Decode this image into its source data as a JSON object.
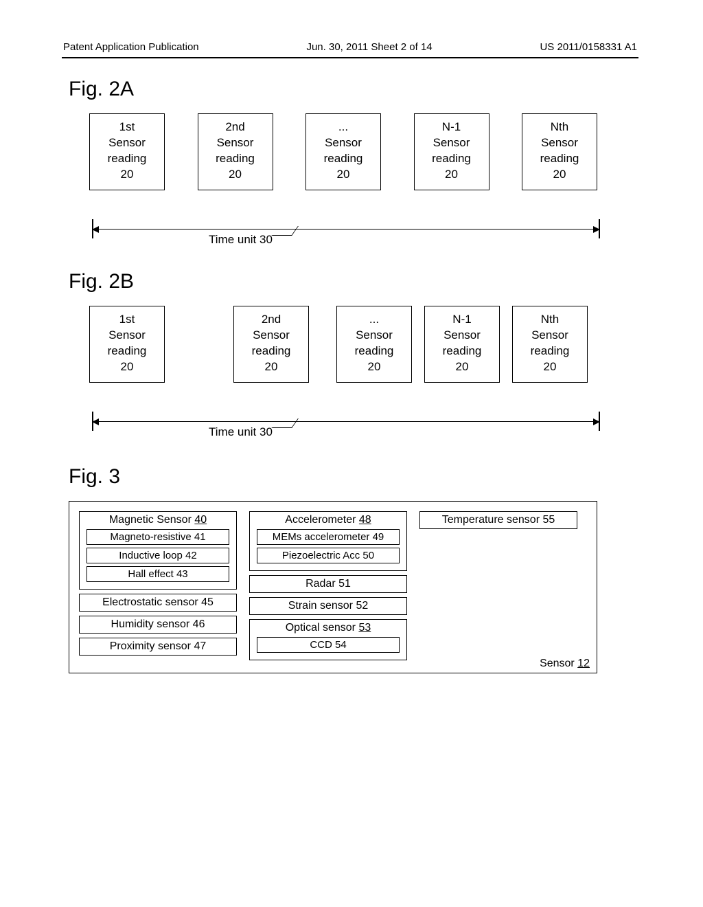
{
  "header": {
    "left": "Patent Application Publication",
    "center": "Jun. 30, 2011  Sheet 2 of 14",
    "right": "US 2011/0158331 A1"
  },
  "fig2a": {
    "label": "Fig. 2A",
    "boxes": [
      {
        "line1": "1st",
        "line2": "Sensor",
        "line3": "reading",
        "line4": "20"
      },
      {
        "line1": "2nd",
        "line2": "Sensor",
        "line3": "reading",
        "line4": "20"
      },
      {
        "line1": "...",
        "line2": "Sensor",
        "line3": "reading",
        "line4": "20"
      },
      {
        "line1": "N-1",
        "line2": "Sensor",
        "line3": "reading",
        "line4": "20"
      },
      {
        "line1": "Nth",
        "line2": "Sensor",
        "line3": "reading",
        "line4": "20"
      }
    ],
    "time_label": "Time unit 30"
  },
  "fig2b": {
    "label": "Fig. 2B",
    "boxes": [
      {
        "line1": "1st",
        "line2": "Sensor",
        "line3": "reading",
        "line4": "20"
      },
      {
        "line1": "2nd",
        "line2": "Sensor",
        "line3": "reading",
        "line4": "20"
      },
      {
        "line1": "...",
        "line2": "Sensor",
        "line3": "reading",
        "line4": "20"
      },
      {
        "line1": "N-1",
        "line2": "Sensor",
        "line3": "reading",
        "line4": "20"
      },
      {
        "line1": "Nth",
        "line2": "Sensor",
        "line3": "reading",
        "line4": "20"
      }
    ],
    "time_label": "Time unit 30"
  },
  "fig3": {
    "label": "Fig. 3",
    "col1": {
      "magnetic": {
        "title_a": "Magnetic Sensor ",
        "title_num": "40",
        "sub1": "Magneto-resistive 41",
        "sub2": "Inductive loop 42",
        "sub3": "Hall effect 43"
      },
      "electrostatic": "Electrostatic sensor 45",
      "humidity": "Humidity sensor 46",
      "proximity": "Proximity sensor 47"
    },
    "col2": {
      "accel": {
        "title_a": "Accelerometer ",
        "title_num": "48",
        "sub1": "MEMs accelerometer 49",
        "sub2": "Piezoelectric Acc 50"
      },
      "radar": "Radar 51",
      "strain": "Strain sensor 52",
      "optical": {
        "title_a": "Optical sensor ",
        "title_num": "53",
        "sub1": "CCD 54"
      }
    },
    "col3": {
      "temp": "Temperature sensor 55"
    },
    "outer_label_a": "Sensor ",
    "outer_label_num": "12"
  }
}
